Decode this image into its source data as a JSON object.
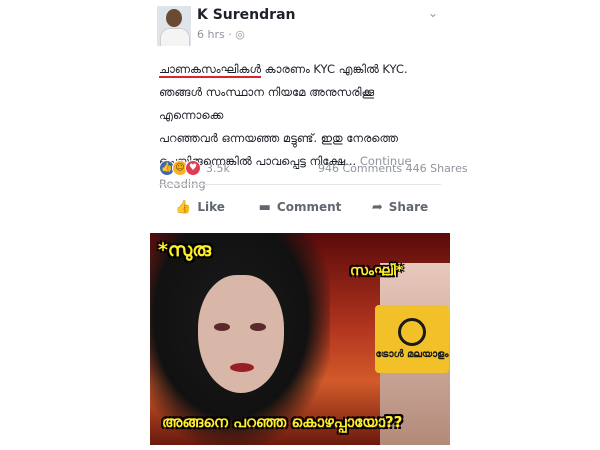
{
  "post": {
    "author": "K Surendran",
    "time": "6 hrs",
    "privacy_icon": "globe-icon",
    "text_highlight": "ചാണകസംഘികൾ",
    "text_rest_line1": " കാരണം KYC എങ്കിൽ KYC.",
    "text_line2": "ഞങ്ങൾ സംസ്ഥാന നിയമേ അനുസരിക്കൂ എന്നൊക്കെ",
    "text_line3": "പറഞ്ഞവർ ഒന്നയഞ്ഞ മട്ടുണ്ട്. ഇതു നേരത്തെ",
    "text_line4": "ചെയ്തിരുന്നെങ്കിൽ പാവപ്പെട്ട നിക്ഷേ...",
    "continue": "Continue",
    "reading": "Reading",
    "reaction_count": "3.5k",
    "comments": "946 Comments",
    "shares": "446 Shares"
  },
  "actions": {
    "like": "Like",
    "comment": "Comment",
    "share": "Share"
  },
  "meme": {
    "caption_top_left": "*സുരു",
    "caption_top_right": "സംഘി*",
    "logo_text": "ട്രോൾ മലയാളം",
    "caption_bottom": "അങ്ങനെ പറഞ്ഞ കൊഴപ്പായോ??"
  }
}
